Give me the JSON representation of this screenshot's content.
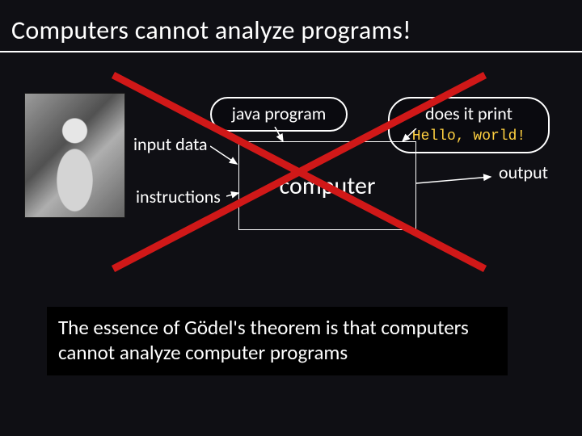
{
  "title": "Computers cannot analyze programs!",
  "bubble_java": "java program",
  "bubble_right_line1": "does it print",
  "bubble_right_line2": "Hello, world!",
  "label_inputdata": "input data",
  "label_instructions": "instructions",
  "label_output": "output",
  "computer": "computer",
  "caption": "The essence of Gödel's theorem is that computers cannot analyze computer programs"
}
